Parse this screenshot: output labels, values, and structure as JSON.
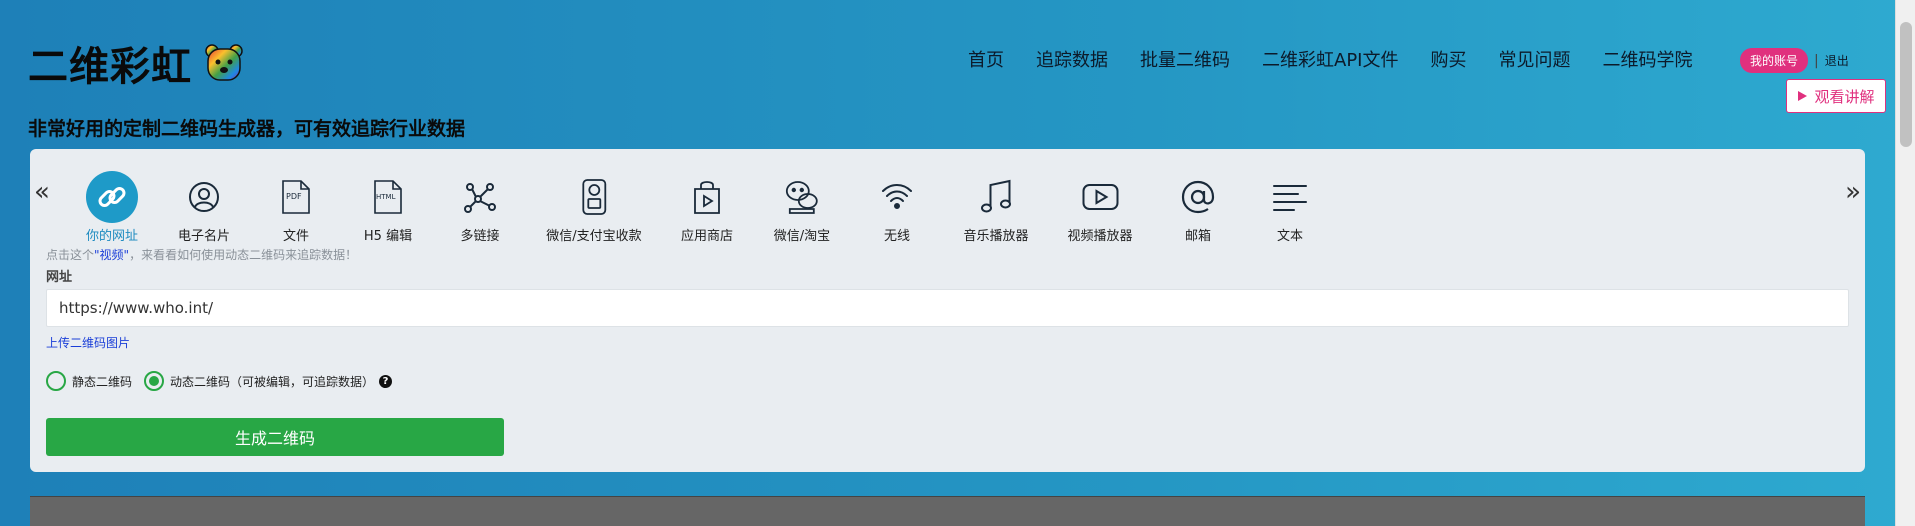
{
  "header": {
    "logo_text": "二维彩虹",
    "subtitle": "非常好用的定制二维码生成器，可有效追踪行业数据"
  },
  "nav": {
    "items": [
      "首页",
      "追踪数据",
      "批量二维码",
      "二维彩虹API文件",
      "购买",
      "常见问题",
      "二维码学院"
    ]
  },
  "account": {
    "badge": "我的账号",
    "separator": "|",
    "logout": "退出"
  },
  "watch_button": {
    "icon": "play-icon",
    "label": "观看讲解"
  },
  "carousel": {
    "prev": "«",
    "next": "»"
  },
  "qr_types": [
    {
      "label": "你的网址",
      "icon": "link-icon",
      "active": true
    },
    {
      "label": "电子名片",
      "icon": "user-icon",
      "active": false
    },
    {
      "label": "文件",
      "icon": "pdf-icon",
      "active": false
    },
    {
      "label": "H5 编辑",
      "icon": "html-icon",
      "active": false
    },
    {
      "label": "多链接",
      "icon": "multi-link-icon",
      "active": false
    },
    {
      "label": "微信/支付宝收款",
      "icon": "payment-icon",
      "active": false
    },
    {
      "label": "应用商店",
      "icon": "app-store-icon",
      "active": false
    },
    {
      "label": "微信/淘宝",
      "icon": "wechat-icon",
      "active": false
    },
    {
      "label": "无线",
      "icon": "wifi-icon",
      "active": false
    },
    {
      "label": "音乐播放器",
      "icon": "music-icon",
      "active": false
    },
    {
      "label": "视频播放器",
      "icon": "video-icon",
      "active": false
    },
    {
      "label": "邮箱",
      "icon": "email-icon",
      "active": false
    },
    {
      "label": "文本",
      "icon": "text-icon",
      "active": false
    }
  ],
  "hint": {
    "prefix": "点击这个",
    "link": "\"视频\"",
    "suffix": "，来看看如何使用动态二维码来追踪数据！"
  },
  "url_field": {
    "label": "网址",
    "value": "https://www.who.int/"
  },
  "upload_link": "上传二维码图片",
  "mode": {
    "static_label": "静态二维码",
    "dynamic_label": "动态二维码（可被编辑，可追踪数据）",
    "selected": "dynamic"
  },
  "generate_button": "生成二维码",
  "colors": {
    "accent": "#1e9ac8",
    "brand_pink": "#e0307e",
    "green": "#28a745"
  }
}
